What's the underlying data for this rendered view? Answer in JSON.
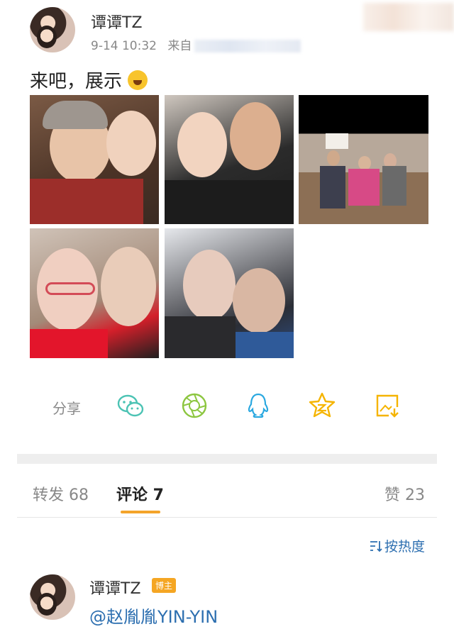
{
  "post": {
    "author": "谭谭TZ",
    "time": "9-14 10:32",
    "source_prefix": "来自",
    "text": "来吧，展示"
  },
  "photos": [
    {
      "alt": "photo-1"
    },
    {
      "alt": "photo-2"
    },
    {
      "alt": "photo-3"
    },
    {
      "alt": "photo-4"
    },
    {
      "alt": "photo-5"
    }
  ],
  "share": {
    "label": "分享",
    "icons": [
      "wechat-icon",
      "moments-icon",
      "qq-icon",
      "qzone-icon",
      "save-image-icon"
    ]
  },
  "tabs": {
    "repost": "转发 68",
    "comments": "评论 7",
    "likes": "赞 23"
  },
  "sort": {
    "label": "按热度"
  },
  "comment": {
    "author": "谭谭TZ",
    "badge": "博主",
    "text": "@赵胤胤YIN-YIN"
  },
  "colors": {
    "accent": "#f4a42a",
    "link": "#2d6fb0",
    "share_icon": "#4cc3b4",
    "qzone_icon": "#f5b400"
  }
}
